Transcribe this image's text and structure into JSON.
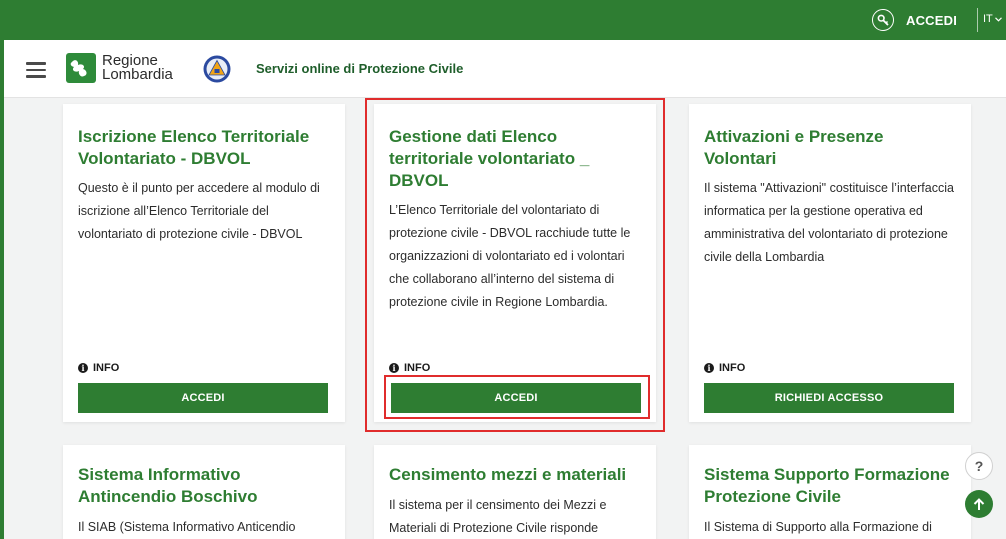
{
  "topbar": {
    "login_label": "ACCEDI",
    "language": "IT",
    "icons": {
      "login": "key-icon",
      "language": "chevron-down-icon"
    }
  },
  "header": {
    "logo_line1": "Regione",
    "logo_line2": "Lombardia",
    "title": "Servizi online di Protezione Civile",
    "icons": {
      "menu": "hamburger-menu-icon",
      "civil_protection": "protezione-civile-emblem"
    }
  },
  "cards": [
    {
      "title": "Iscrizione Elenco Territoriale Volontariato - DBVOL",
      "description": "Questo è il punto per accedere al modulo di iscrizione all’Elenco Territoriale del volontariato di protezione civile - DBVOL",
      "info_label": "INFO",
      "button_label": "ACCEDI"
    },
    {
      "title": "Gestione dati Elenco territoriale volontariato _ DBVOL",
      "description": "L’Elenco Territoriale del volontariato di protezione civile - DBVOL racchiude tutte le organizzazioni di volontariato ed i volontari che collaborano all’interno del sistema di protezione civile in Regione Lombardia.",
      "info_label": "INFO",
      "button_label": "ACCEDI"
    },
    {
      "title": "Attivazioni e Presenze Volontari",
      "description": "Il sistema \"Attivazioni\" costituisce l’interfaccia informatica per la gestione operativa ed amministrativa del volontariato di protezione civile della Lombardia",
      "info_label": "INFO",
      "button_label": "RICHIEDI ACCESSO"
    },
    {
      "title": "Sistema Informativo Antincendio Boschivo",
      "description": "Il SIAB (Sistema Informativo Anticendio"
    },
    {
      "title": "Censimento mezzi e materiali",
      "description": "Il sistema per il censimento dei Mezzi e Materiali di Protezione Civile risponde"
    },
    {
      "title": "Sistema Supporto Formazione Protezione Civile",
      "description": "Il Sistema di Supporto alla Formazione di"
    }
  ],
  "floating": {
    "help_label": "?",
    "icons": {
      "help": "help-icon",
      "scroll_top": "arrow-up-icon"
    }
  },
  "colors": {
    "brand_green": "#2e7d32",
    "title_green": "#2e7d32",
    "highlight_red": "#e02c2c",
    "background": "#f2f3f3"
  }
}
